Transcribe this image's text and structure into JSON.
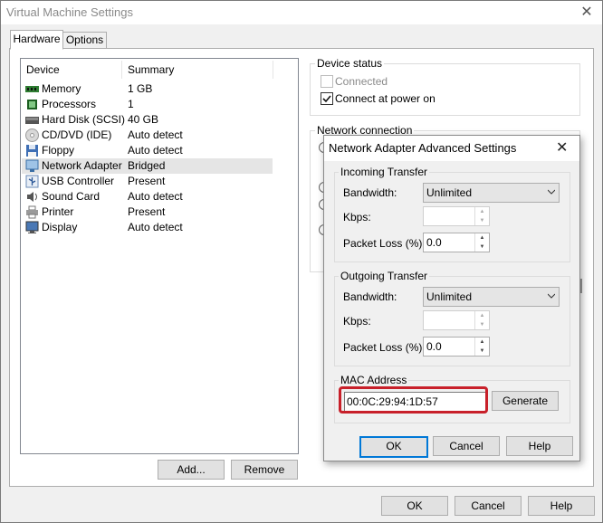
{
  "window": {
    "title": "Virtual Machine Settings"
  },
  "tabs": [
    {
      "label": "Hardware"
    },
    {
      "label": "Options"
    }
  ],
  "device_list": {
    "headers": {
      "device": "Device",
      "summary": "Summary"
    },
    "rows": [
      {
        "device": "Memory",
        "summary": "1 GB",
        "icon": "memory-icon"
      },
      {
        "device": "Processors",
        "summary": "1",
        "icon": "processor-icon"
      },
      {
        "device": "Hard Disk (SCSI)",
        "summary": "40 GB",
        "icon": "hard-disk-icon"
      },
      {
        "device": "CD/DVD (IDE)",
        "summary": "Auto detect",
        "icon": "cd-dvd-icon"
      },
      {
        "device": "Floppy",
        "summary": "Auto detect",
        "icon": "floppy-icon"
      },
      {
        "device": "Network Adapter",
        "summary": "Bridged",
        "icon": "network-adapter-icon",
        "selected": true
      },
      {
        "device": "USB Controller",
        "summary": "Present",
        "icon": "usb-icon"
      },
      {
        "device": "Sound Card",
        "summary": "Auto detect",
        "icon": "sound-card-icon"
      },
      {
        "device": "Printer",
        "summary": "Present",
        "icon": "printer-icon"
      },
      {
        "device": "Display",
        "summary": "Auto detect",
        "icon": "display-icon"
      }
    ]
  },
  "list_buttons": {
    "add": "Add...",
    "remove": "Remove"
  },
  "device_status": {
    "label": "Device status",
    "connected": {
      "label": "Connected",
      "checked": false,
      "disabled": true
    },
    "connect_at_power_on": {
      "label": "Connect at power on",
      "checked": true
    }
  },
  "network_connection": {
    "label": "Network connection"
  },
  "dialog": {
    "title": "Network Adapter Advanced Settings",
    "incoming": {
      "label": "Incoming Transfer",
      "bandwidth_label": "Bandwidth:",
      "bandwidth_value": "Unlimited",
      "kbps_label": "Kbps:",
      "kbps_value": "",
      "packet_loss_label": "Packet Loss (%):",
      "packet_loss_value": "0.0"
    },
    "outgoing": {
      "label": "Outgoing Transfer",
      "bandwidth_label": "Bandwidth:",
      "bandwidth_value": "Unlimited",
      "kbps_label": "Kbps:",
      "kbps_value": "",
      "packet_loss_label": "Packet Loss (%):",
      "packet_loss_value": "0.0"
    },
    "mac": {
      "label": "MAC Address",
      "value": "00:0C:29:94:1D:57",
      "generate": "Generate"
    },
    "buttons": {
      "ok": "OK",
      "cancel": "Cancel",
      "help": "Help"
    }
  },
  "footer_buttons": {
    "ok": "OK",
    "cancel": "Cancel",
    "help": "Help"
  },
  "colors": {
    "highlight": "#c8202a",
    "default_button_border": "#0078d7",
    "selected_row": "#e5e5e5"
  }
}
